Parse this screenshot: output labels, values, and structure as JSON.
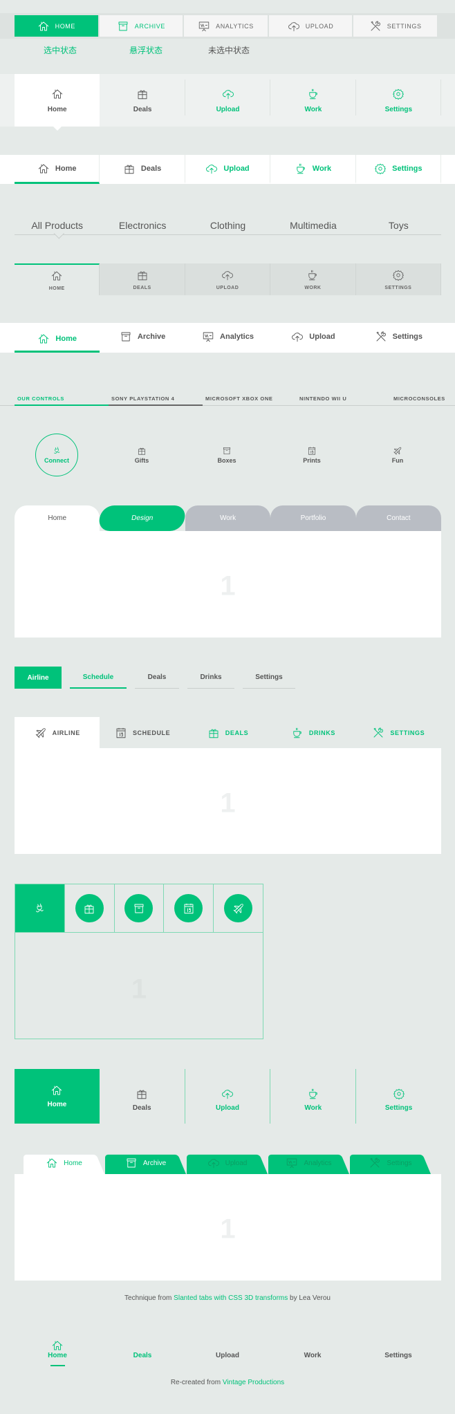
{
  "colors": {
    "accent": "#00c27a",
    "background": "#e5eae8",
    "inactive_tab": "#b9bdc4"
  },
  "nav1": {
    "tabs": [
      {
        "label": "Home",
        "icon": "home",
        "state": "active"
      },
      {
        "label": "Archive",
        "icon": "archive",
        "state": "hover"
      },
      {
        "label": "Analytics",
        "icon": "analytics",
        "state": "normal"
      },
      {
        "label": "Upload",
        "icon": "upload",
        "state": "normal"
      },
      {
        "label": "Settings",
        "icon": "tools",
        "state": "normal"
      }
    ],
    "states": [
      "选中状态",
      "悬浮状态",
      "未选中状态"
    ]
  },
  "nav2": {
    "tabs": [
      {
        "label": "Home",
        "icon": "home",
        "state": "active"
      },
      {
        "label": "Deals",
        "icon": "gift",
        "state": "normal"
      },
      {
        "label": "Upload",
        "icon": "upload",
        "state": "hover"
      },
      {
        "label": "Work",
        "icon": "cup",
        "state": "hover"
      },
      {
        "label": "Settings",
        "icon": "gear",
        "state": "hover"
      }
    ]
  },
  "nav3": {
    "tabs": [
      {
        "label": "Home",
        "icon": "home",
        "state": "active"
      },
      {
        "label": "Deals",
        "icon": "gift",
        "state": "normal"
      },
      {
        "label": "Upload",
        "icon": "upload",
        "state": "hover"
      },
      {
        "label": "Work",
        "icon": "cup",
        "state": "hover"
      },
      {
        "label": "Settings",
        "icon": "gear",
        "state": "hover"
      }
    ]
  },
  "products": {
    "tabs": [
      {
        "label": "All Products",
        "state": "active"
      },
      {
        "label": "Electronics",
        "state": "normal"
      },
      {
        "label": "Clothing",
        "state": "hover"
      },
      {
        "label": "Multimedia",
        "state": "hover"
      },
      {
        "label": "Toys",
        "state": "hover"
      }
    ]
  },
  "nav5": {
    "tabs": [
      {
        "label": "Home",
        "icon": "home",
        "state": "active"
      },
      {
        "label": "Deals",
        "icon": "gift",
        "state": "hover"
      },
      {
        "label": "Upload",
        "icon": "upload",
        "state": "normal"
      },
      {
        "label": "Work",
        "icon": "cup",
        "state": "normal"
      },
      {
        "label": "Settings",
        "icon": "gear",
        "state": "normal"
      }
    ]
  },
  "nav6": {
    "tabs": [
      {
        "label": "Home",
        "icon": "home",
        "state": "active"
      },
      {
        "label": "Archive",
        "icon": "archive",
        "state": "normal"
      },
      {
        "label": "Analytics",
        "icon": "analytics",
        "state": "normal"
      },
      {
        "label": "Upload",
        "icon": "upload",
        "state": "normal"
      },
      {
        "label": "Settings",
        "icon": "tools",
        "state": "normal"
      }
    ]
  },
  "consoles": {
    "tabs": [
      {
        "label": "Our Controls",
        "state": "active"
      },
      {
        "label": "Sony Playstation 4",
        "state": "hover"
      },
      {
        "label": "Microsoft Xbox One",
        "state": "normal"
      },
      {
        "label": "Nintendo Wii U",
        "state": "normal"
      },
      {
        "label": "Microconsoles",
        "state": "normal"
      }
    ]
  },
  "circles": {
    "tabs": [
      {
        "label": "Connect",
        "icon": "plug",
        "state": "active"
      },
      {
        "label": "Gifts",
        "icon": "gift",
        "state": "hover"
      },
      {
        "label": "Boxes",
        "icon": "archive",
        "state": "normal"
      },
      {
        "label": "Prints",
        "icon": "calendar",
        "state": "normal"
      },
      {
        "label": "Fun",
        "icon": "plane",
        "state": "normal"
      }
    ]
  },
  "rounded": {
    "tabs": [
      {
        "label": "Home",
        "state": "active"
      },
      {
        "label": "Design",
        "state": "hover"
      },
      {
        "label": "Work",
        "state": "normal"
      },
      {
        "label": "Portfolio",
        "state": "normal"
      },
      {
        "label": "Contact",
        "state": "normal"
      }
    ],
    "panel": "1"
  },
  "pills": {
    "tabs": [
      {
        "label": "Airline",
        "state": "active"
      },
      {
        "label": "Schedule",
        "state": "hover"
      },
      {
        "label": "Deals",
        "state": "normal"
      },
      {
        "label": "Drinks",
        "state": "normal"
      },
      {
        "label": "Settings",
        "state": "normal"
      }
    ]
  },
  "travel": {
    "tabs": [
      {
        "label": "Airline",
        "icon": "plane",
        "state": "active"
      },
      {
        "label": "Schedule",
        "icon": "calendar",
        "state": "normal"
      },
      {
        "label": "Deals",
        "icon": "gift",
        "state": "hover"
      },
      {
        "label": "Drinks",
        "icon": "cup",
        "state": "hover"
      },
      {
        "label": "Settings",
        "icon": "tools",
        "state": "hover"
      }
    ],
    "panel": "1"
  },
  "boxed": {
    "tabs": [
      {
        "icon": "plug",
        "state": "active"
      },
      {
        "icon": "gift",
        "state": "normal"
      },
      {
        "icon": "archive",
        "state": "normal"
      },
      {
        "icon": "calendar",
        "state": "normal"
      },
      {
        "icon": "plane",
        "state": "normal"
      }
    ],
    "panel": "1"
  },
  "bigtabs": {
    "tabs": [
      {
        "label": "Home",
        "icon": "home",
        "state": "active"
      },
      {
        "label": "Deals",
        "icon": "gift",
        "state": "normal"
      },
      {
        "label": "Upload",
        "icon": "upload",
        "state": "hover"
      },
      {
        "label": "Work",
        "icon": "cup",
        "state": "hover"
      },
      {
        "label": "Settings",
        "icon": "gear",
        "state": "hover"
      }
    ]
  },
  "slanted": {
    "tabs": [
      {
        "label": "Home",
        "icon": "home",
        "state": "active"
      },
      {
        "label": "Archive",
        "icon": "archive",
        "state": "hover"
      },
      {
        "label": "Upload",
        "icon": "upload",
        "state": "normal"
      },
      {
        "label": "Analytics",
        "icon": "analytics",
        "state": "normal"
      },
      {
        "label": "Settings",
        "icon": "tools",
        "state": "normal"
      }
    ],
    "panel": "1",
    "caption": {
      "before": "Technique from ",
      "link": "Slanted tabs with CSS 3D transforms",
      "after": " by Lea Verou"
    }
  },
  "bottomnav": {
    "tabs": [
      {
        "label": "Home",
        "icon": "home",
        "state": "active"
      },
      {
        "label": "Deals",
        "state": "hover"
      },
      {
        "label": "Upload",
        "state": "normal"
      },
      {
        "label": "Work",
        "state": "normal"
      },
      {
        "label": "Settings",
        "state": "normal"
      }
    ]
  },
  "footer": {
    "before": "Re-created from ",
    "link": "Vintage Productions"
  }
}
